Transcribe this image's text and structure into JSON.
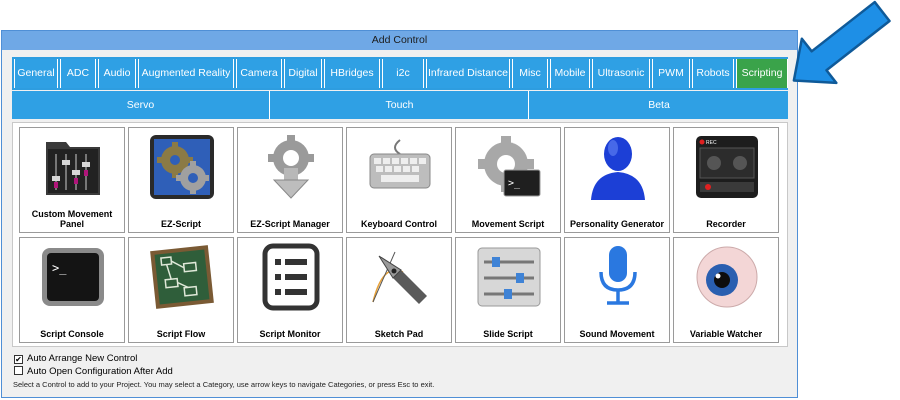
{
  "window": {
    "title": "Add Control"
  },
  "tabs": [
    {
      "label": "General"
    },
    {
      "label": "ADC"
    },
    {
      "label": "Audio"
    },
    {
      "label": "Augmented Reality"
    },
    {
      "label": "Camera"
    },
    {
      "label": "Digital"
    },
    {
      "label": "HBridges"
    },
    {
      "label": "i2c"
    },
    {
      "label": "Infrared Distance"
    },
    {
      "label": "Misc"
    },
    {
      "label": "Mobile"
    },
    {
      "label": "Ultrasonic"
    },
    {
      "label": "PWM"
    },
    {
      "label": "Robots"
    },
    {
      "label": "Scripting"
    }
  ],
  "active_tab": "Scripting",
  "subtabs": [
    {
      "label": "Servo"
    },
    {
      "label": "Touch"
    },
    {
      "label": "Beta"
    }
  ],
  "controls": [
    {
      "label": "Custom Movement Panel",
      "icon": "equalizer-folder-icon"
    },
    {
      "label": "EZ-Script",
      "icon": "gears-icon"
    },
    {
      "label": "EZ-Script Manager",
      "icon": "gear-download-icon"
    },
    {
      "label": "Keyboard Control",
      "icon": "keyboard-icon"
    },
    {
      "label": "Movement Script",
      "icon": "gear-terminal-icon"
    },
    {
      "label": "Personality Generator",
      "icon": "person-bust-icon"
    },
    {
      "label": "Recorder",
      "icon": "recorder-icon"
    },
    {
      "label": "Script Console",
      "icon": "terminal-icon"
    },
    {
      "label": "Script Flow",
      "icon": "flowchart-board-icon"
    },
    {
      "label": "Script Monitor",
      "icon": "list-icon"
    },
    {
      "label": "Sketch Pad",
      "icon": "pen-nib-icon"
    },
    {
      "label": "Slide Script",
      "icon": "sliders-icon"
    },
    {
      "label": "Sound Movement",
      "icon": "microphone-icon"
    },
    {
      "label": "Variable Watcher",
      "icon": "eyeball-icon"
    }
  ],
  "options": {
    "auto_arrange": {
      "label": "Auto Arrange New Control",
      "checked": true,
      "mark": "✔"
    },
    "auto_open": {
      "label": "Auto Open Configuration After Add",
      "checked": false,
      "mark": ""
    }
  },
  "hint": "Select a Control to add to your Project. You may select a Category, use arrow keys to navigate Categories, or press Esc to exit.",
  "colors": {
    "tab_blue": "#2fa0e4",
    "tab_active": "#3aa34a",
    "title_bar": "#6fa8e6",
    "arrow": "#1e8fe6"
  }
}
